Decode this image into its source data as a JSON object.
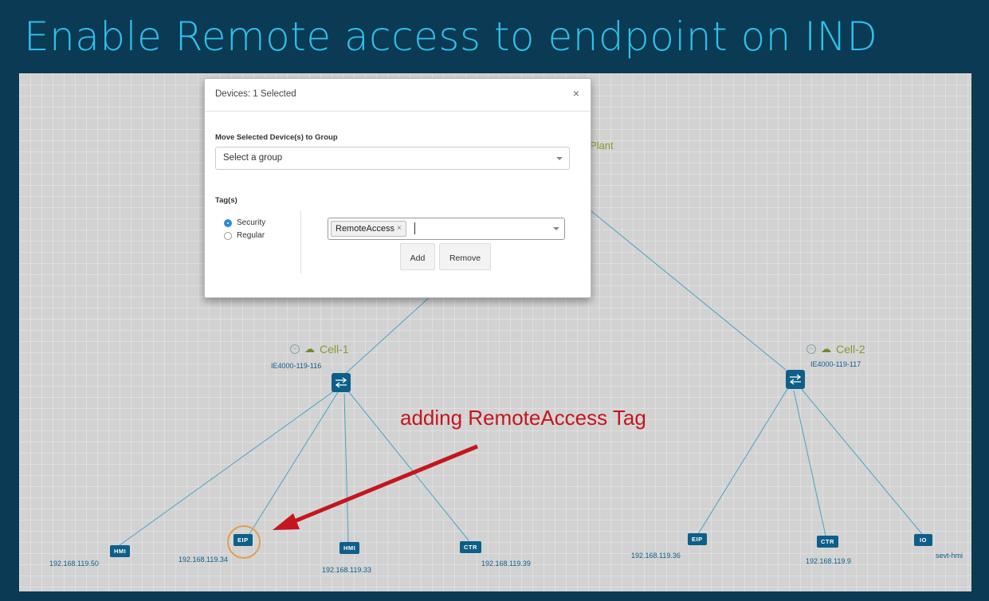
{
  "slide_title": "Enable Remote access to endpoint on IND",
  "topology": {
    "plant_label": "Plant",
    "cells": [
      {
        "name": "Cell-1",
        "switch_name": "IE4000-119-116"
      },
      {
        "name": "Cell-2",
        "switch_name": "IE4000-119-117"
      }
    ],
    "devices": [
      {
        "type": "HMI",
        "ip": "192.168.119.50"
      },
      {
        "type": "EIP",
        "ip": "192.168.119.34"
      },
      {
        "type": "HMI",
        "ip": "192.168.119.33"
      },
      {
        "type": "CTR",
        "ip": "192.168.119.39"
      },
      {
        "type": "EIP",
        "ip": "192.168.119.36"
      },
      {
        "type": "CTR",
        "ip": "192.168.119.9"
      },
      {
        "type": "IO",
        "ip": "sevt-hmi"
      }
    ],
    "icons": {
      "collapse": "collapse-icon",
      "cloud": "cloud-icon",
      "switch": "switch-icon"
    },
    "colors": {
      "device": "#0d5f88",
      "link": "#4aa3c4",
      "group_label": "#8a9a2a",
      "highlight": "#e0a050"
    }
  },
  "annotation": {
    "text": "adding RemoteAccess Tag",
    "color": "#c4161c"
  },
  "modal": {
    "title": "Devices: 1 Selected",
    "close_symbol": "×",
    "group_section_label": "Move Selected Device(s) to Group",
    "group_select_value": "Select a group",
    "tags_section_label": "Tag(s)",
    "tag_types": [
      {
        "label": "Security",
        "checked": true
      },
      {
        "label": "Regular",
        "checked": false
      }
    ],
    "tag_chips": [
      {
        "label": "RemoteAccess",
        "remove_symbol": "×"
      }
    ],
    "add_button": "Add",
    "remove_button": "Remove"
  }
}
